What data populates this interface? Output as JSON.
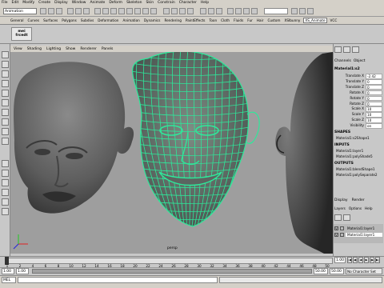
{
  "menubar": {
    "items": [
      "File",
      "Edit",
      "Modify",
      "Create",
      "Display",
      "Window",
      "Animate",
      "Deform",
      "Skeleton",
      "Skin",
      "Constrain",
      "Character",
      "Help"
    ]
  },
  "status": {
    "mode": "Animation"
  },
  "shelf": {
    "tabs": [
      "General",
      "Curves",
      "Surfaces",
      "Polygons",
      "Subdivs",
      "Deformation",
      "Animation",
      "Dynamics",
      "Rendering",
      "PaintEffects",
      "Toon",
      "Cloth",
      "Fluids",
      "Fur",
      "Hair",
      "Custom",
      "XSIbunny",
      "XS_Animate",
      "VCC"
    ],
    "active_tab": "XS_Animate",
    "icon_label": "mei\nfrcedt"
  },
  "panel": {
    "menus": [
      "View",
      "Shading",
      "Lighting",
      "Show",
      "Renderer",
      "Panels"
    ],
    "camera_label": "persp"
  },
  "channel_box": {
    "header": [
      "Channels",
      "Object"
    ],
    "object_name": "Material1:s2",
    "attributes": [
      {
        "name": "Translate X",
        "value": "-2.42"
      },
      {
        "name": "Translate Y",
        "value": "0"
      },
      {
        "name": "Translate Z",
        "value": "0"
      },
      {
        "name": "Rotate X",
        "value": "0"
      },
      {
        "name": "Rotate Y",
        "value": "0"
      },
      {
        "name": "Rotate Z",
        "value": "0"
      },
      {
        "name": "Scale X",
        "value": "10"
      },
      {
        "name": "Scale Y",
        "value": "10"
      },
      {
        "name": "Scale Z",
        "value": "10"
      },
      {
        "name": "Visibility",
        "value": "on"
      }
    ],
    "shapes_header": "SHAPES",
    "shapes": [
      "Material1:s2Shape1"
    ],
    "inputs_header": "INPUTS",
    "inputs_top": [
      "Material1:layer1",
      "Material1:polyShade5"
    ],
    "outputs_header": "OUTPUTS",
    "outputs": [
      "Material1:blendShape1",
      "Material1:polySeparate2"
    ]
  },
  "layer_editor": {
    "tabs": [
      "Display",
      "Render"
    ],
    "menus": [
      "Layers",
      "Options",
      "Help"
    ],
    "layers": [
      {
        "name": "Material1:layer1",
        "visible": "V",
        "selected": false
      },
      {
        "name": "Material1:layer1",
        "visible": "V",
        "selected": true
      }
    ]
  },
  "time": {
    "ticks": [
      "1",
      "2",
      "4",
      "6",
      "8",
      "10",
      "12",
      "14",
      "16",
      "18",
      "20",
      "22",
      "24",
      "26",
      "28",
      "30",
      "32",
      "34",
      "36",
      "38",
      "40",
      "42",
      "44",
      "46",
      "48",
      "50"
    ],
    "current_frame": "1.00",
    "range_start": "1.00",
    "range_end_a": "50.00",
    "range_end_b": "50.00",
    "character_set": "No Character Set"
  },
  "command": {
    "mode": "MEL"
  },
  "colors": {
    "wireframe": "#2ee89a",
    "head_shade": "#5a5a5a",
    "viewport_bg": "#9e9e9e"
  }
}
